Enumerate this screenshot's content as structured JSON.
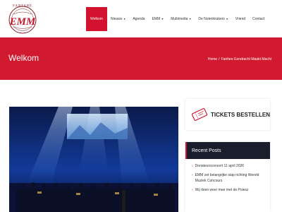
{
  "logo": {
    "top_text": "FANFARE",
    "monogram": "EMM"
  },
  "nav": {
    "items": [
      {
        "label": "Welkom",
        "active": true,
        "dropdown": false
      },
      {
        "label": "Nieuws",
        "active": false,
        "dropdown": true
      },
      {
        "label": "Agenda",
        "active": false,
        "dropdown": false
      },
      {
        "label": "EMM",
        "active": false,
        "dropdown": true
      },
      {
        "label": "Multimedia",
        "active": false,
        "dropdown": true
      },
      {
        "label": "De Notenkrakers",
        "active": false,
        "dropdown": true
      },
      {
        "label": "Vriend",
        "active": false,
        "dropdown": false
      },
      {
        "label": "Contact",
        "active": false,
        "dropdown": false
      }
    ]
  },
  "hero": {
    "title": "Welkom",
    "breadcrumb": {
      "home": "Home",
      "separator": "/",
      "current": "Fanfare Eendracht Maakt Macht"
    }
  },
  "sidebar": {
    "tickets_label": "TICKETS BESTELLEN",
    "recent_posts_title": "Recent Posts",
    "recent_posts": [
      "Donateursconcert 11 april 2026",
      "EMM zet belangrijke stap richting Wereld Muziek Concours",
      "Wij doen weer mee met de Poiesz"
    ]
  },
  "colors": {
    "accent": "#d2122e",
    "hero": "#d11a30",
    "dark": "#1a1d2b"
  }
}
